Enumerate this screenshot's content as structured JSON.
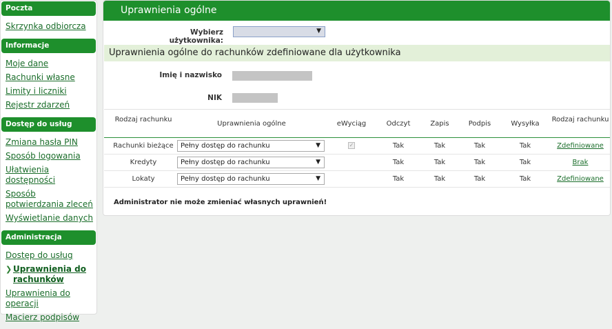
{
  "sidebar": {
    "sections": [
      {
        "title": "Poczta",
        "items": [
          "Skrzynka odbiorcza"
        ]
      },
      {
        "title": "Informacje",
        "items": [
          "Moje dane",
          "Rachunki własne",
          "Limity i liczniki",
          "Rejestr zdarzeń"
        ]
      },
      {
        "title": "Dostęp do usług",
        "items": [
          "Zmiana hasła PIN",
          "Sposób logowania",
          "Ułatwienia dostępności",
          "Sposób potwierdzania zleceń",
          "Wyświetlanie danych"
        ]
      },
      {
        "title": "Administracja",
        "items": [
          "Dostęp do usług",
          "Uprawnienia do rachunków",
          "Uprawnienia do operacji",
          "Macierz podpisów"
        ]
      }
    ]
  },
  "main": {
    "title": "Uprawnienia ogólne",
    "user_label": "Wybierz użytkownika:",
    "user_value": "",
    "subtitle": "Uprawnienia ogólne do rachunków zdefiniowane dla użytkownika",
    "name_label": "Imię i nazwisko",
    "nik_label": "NIK",
    "table": {
      "headers": [
        "Rodzaj rachunku",
        "Uprawnienia ogólne",
        "eWyciąg",
        "Odczyt",
        "Zapis",
        "Podpis",
        "Wysyłka",
        "Rodzaj rachunku"
      ],
      "rows": [
        {
          "type": "Rachunki bieżące",
          "perm": "Pełny dostęp do rachunku",
          "ewyciag": true,
          "odczyt": "Tak",
          "zapis": "Tak",
          "podpis": "Tak",
          "wysylka": "Tak",
          "rodzaj": "Zdefiniowane"
        },
        {
          "type": "Kredyty",
          "perm": "Pełny dostęp do rachunku",
          "ewyciag": false,
          "odczyt": "Tak",
          "zapis": "Tak",
          "podpis": "Tak",
          "wysylka": "Tak",
          "rodzaj": "Brak"
        },
        {
          "type": "Lokaty",
          "perm": "Pełny dostęp do rachunku",
          "ewyciag": false,
          "odczyt": "Tak",
          "zapis": "Tak",
          "podpis": "Tak",
          "wysylka": "Tak",
          "rodzaj": "Zdefiniowane"
        }
      ]
    },
    "note": "Administrator nie może zmieniać własnych uprawnień!"
  },
  "icons": {
    "dropdown": "caret-down-icon",
    "active_marker": "chevron-right-icon",
    "checked": "checkbox-icon"
  },
  "colors": {
    "brand_green": "#1e8f2c",
    "subheader_bg": "#e3f0d9",
    "link": "#1a6d2a"
  }
}
